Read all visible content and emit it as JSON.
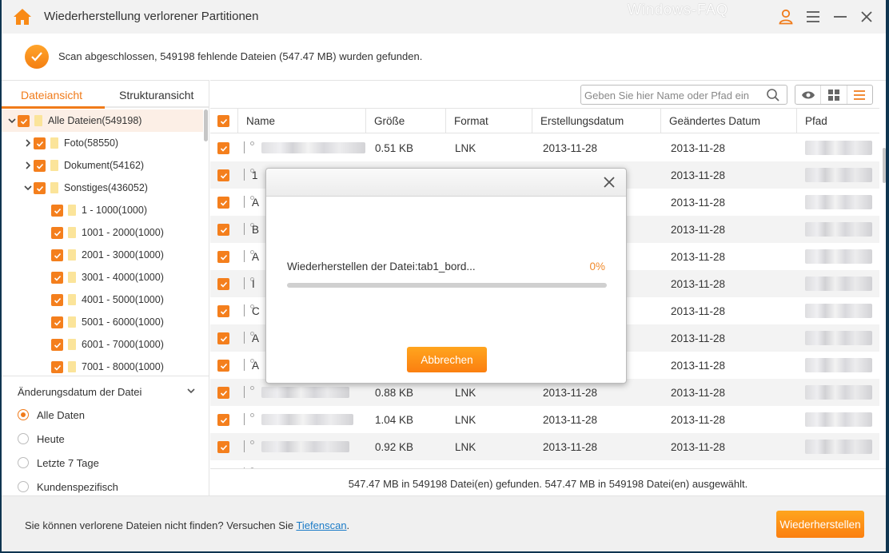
{
  "window": {
    "title": "Wiederherstellung verlorener Partitionen",
    "watermark": "Windows-FAQ",
    "accent_color": "#f07b1a"
  },
  "scan_status": {
    "text": "Scan abgeschlossen, 549198 fehlende Dateien (547.47 MB) wurden gefunden."
  },
  "left_panel": {
    "tabs": [
      {
        "label": "Dateiansicht",
        "active": true
      },
      {
        "label": "Strukturansicht",
        "active": false
      }
    ],
    "tree": [
      {
        "label": "Alle Dateien(549198)",
        "level": 0,
        "expanded": true,
        "checked": true,
        "selected": true
      },
      {
        "label": "Foto(58550)",
        "level": 1,
        "expanded": false,
        "checked": true
      },
      {
        "label": "Dokument(54162)",
        "level": 1,
        "expanded": false,
        "checked": true
      },
      {
        "label": "Sonstiges(436052)",
        "level": 1,
        "expanded": true,
        "checked": true
      },
      {
        "label": "1 - 1000(1000)",
        "level": 2,
        "checked": true
      },
      {
        "label": "1001 - 2000(1000)",
        "level": 2,
        "checked": true
      },
      {
        "label": "2001 - 3000(1000)",
        "level": 2,
        "checked": true
      },
      {
        "label": "3001 - 4000(1000)",
        "level": 2,
        "checked": true
      },
      {
        "label": "4001 - 5000(1000)",
        "level": 2,
        "checked": true
      },
      {
        "label": "5001 - 6000(1000)",
        "level": 2,
        "checked": true
      },
      {
        "label": "6001 - 7000(1000)",
        "level": 2,
        "checked": true
      },
      {
        "label": "7001 - 8000(1000)",
        "level": 2,
        "checked": true
      }
    ],
    "filter": {
      "title": "Änderungsdatum der Datei",
      "options": [
        {
          "label": "Alle Daten",
          "selected": true
        },
        {
          "label": "Heute",
          "selected": false
        },
        {
          "label": "Letzte 7 Tage",
          "selected": false
        },
        {
          "label": "Kundenspezifisch",
          "selected": false
        }
      ]
    }
  },
  "toolbar": {
    "search_placeholder": "Geben Sie hier Name oder Pfad ein",
    "search_value": "",
    "view_modes": [
      "preview",
      "grid",
      "list"
    ],
    "active_view": "list"
  },
  "table": {
    "columns": [
      "Name",
      "Größe",
      "Format",
      "Erstellungsdatum",
      "Geändertes Datum",
      "Pfad"
    ],
    "rows": [
      {
        "name_initial": "",
        "size": "0.51 KB",
        "format": "LNK",
        "created": "2013-11-28",
        "modified": "2013-11-28",
        "checked": true
      },
      {
        "name_initial": "1",
        "size": "",
        "format": "",
        "created": "",
        "modified": "2013-11-28",
        "checked": true
      },
      {
        "name_initial": "A",
        "size": "",
        "format": "",
        "created": "",
        "modified": "2013-11-28",
        "checked": true
      },
      {
        "name_initial": "B",
        "size": "",
        "format": "",
        "created": "",
        "modified": "2013-11-28",
        "checked": true
      },
      {
        "name_initial": "A",
        "size": "",
        "format": "",
        "created": "",
        "modified": "2013-11-28",
        "checked": true
      },
      {
        "name_initial": "I",
        "size": "",
        "format": "",
        "created": "",
        "modified": "2013-11-28",
        "checked": true
      },
      {
        "name_initial": "C",
        "size": "",
        "format": "",
        "created": "",
        "modified": "2013-11-28",
        "checked": true
      },
      {
        "name_initial": "A",
        "size": "",
        "format": "",
        "created": "",
        "modified": "2013-11-28",
        "checked": true
      },
      {
        "name_initial": "A",
        "size": "",
        "format": "",
        "created": "",
        "modified": "2013-11-28",
        "checked": true
      },
      {
        "name_initial": "",
        "size": "0.88 KB",
        "format": "LNK",
        "created": "2013-11-28",
        "modified": "2013-11-28",
        "checked": true
      },
      {
        "name_initial": "",
        "size": "1.04 KB",
        "format": "LNK",
        "created": "2013-11-28",
        "modified": "2013-11-28",
        "checked": true
      },
      {
        "name_initial": "",
        "size": "0.92 KB",
        "format": "LNK",
        "created": "2013-11-28",
        "modified": "2013-11-28",
        "checked": true
      },
      {
        "name_initial": "",
        "size": "",
        "format": "",
        "created": "",
        "modified": "",
        "checked": true
      }
    ],
    "summary": "547.47 MB in 549198 Datei(en) gefunden. 547.47 MB in 549198 Datei(en) ausgewählt."
  },
  "footer": {
    "hint_prefix": "Sie können verlorene Dateien nicht finden? Versuchen Sie ",
    "hint_link": "Tiefenscan",
    "hint_suffix": ".",
    "recover_button": "Wiederherstellen"
  },
  "modal": {
    "message": "Wiederherstellen der Datei:tab1_bord...",
    "progress_percent": 0,
    "progress_label": "0%",
    "cancel_button": "Abbrechen"
  }
}
